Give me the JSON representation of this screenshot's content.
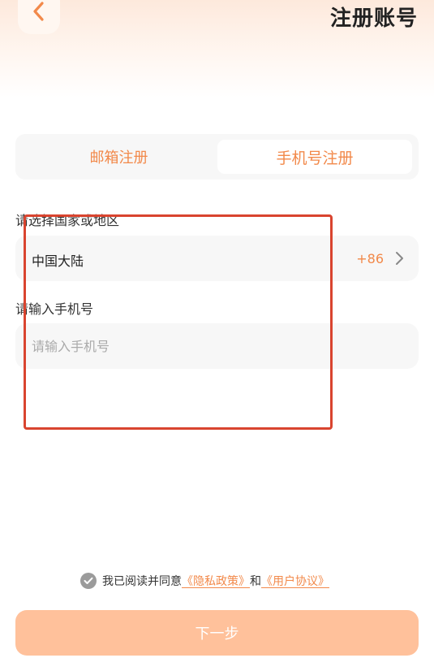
{
  "header": {
    "title": "注册账号",
    "back_icon": "chevron-left-icon"
  },
  "tabs": [
    {
      "label": "邮箱注册",
      "active": false
    },
    {
      "label": "手机号注册",
      "active": true
    }
  ],
  "country": {
    "label": "请选择国家或地区",
    "value": "中国大陆",
    "code": "+86"
  },
  "phone": {
    "label": "请输入手机号",
    "value": "",
    "placeholder": "请输入手机号"
  },
  "agreement": {
    "prefix": "我已阅读并同意",
    "privacy_link": "《隐私政策》",
    "joiner": "和",
    "terms_link": "《用户协议》",
    "checked": true
  },
  "next_button": {
    "label": "下一步"
  },
  "colors": {
    "accent": "#f2894a",
    "highlight": "#d9442f",
    "button_disabled": "#ffc19b"
  }
}
